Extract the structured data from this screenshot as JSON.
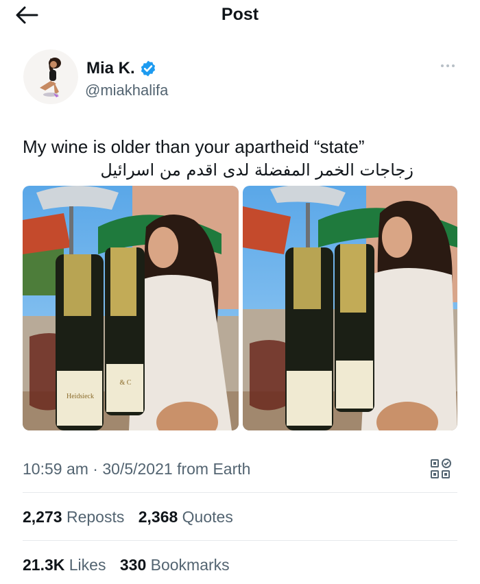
{
  "header": {
    "title": "Post"
  },
  "author": {
    "name": "Mia K.",
    "handle": "@miakhalifa"
  },
  "post": {
    "text": "My wine is older than your apartheid “state”",
    "translation": "زجاجات الخمر المفضلة لدى اقدم من اسرائيل"
  },
  "meta": {
    "time": "10:59 am",
    "separator": "·",
    "date": "30/5/2021",
    "source": "from Earth"
  },
  "stats": {
    "reposts_count": "2,273",
    "reposts_label": "Reposts",
    "quotes_count": "2,368",
    "quotes_label": "Quotes",
    "likes_count": "21.3K",
    "likes_label": "Likes",
    "bookmarks_count": "330",
    "bookmarks_label": "Bookmarks"
  },
  "photo_labels": {
    "bottle_left": "Heidsieck",
    "bottle_right": "& C"
  },
  "colors": {
    "verified": "#1d9bf0",
    "muted": "#536471",
    "text": "#0f1419",
    "divider": "#e6e9ec"
  },
  "icons": {
    "back": "arrow-left-icon",
    "verified": "verified-badge-icon",
    "more": "more-icon",
    "analytics": "qr-analytics-icon"
  }
}
